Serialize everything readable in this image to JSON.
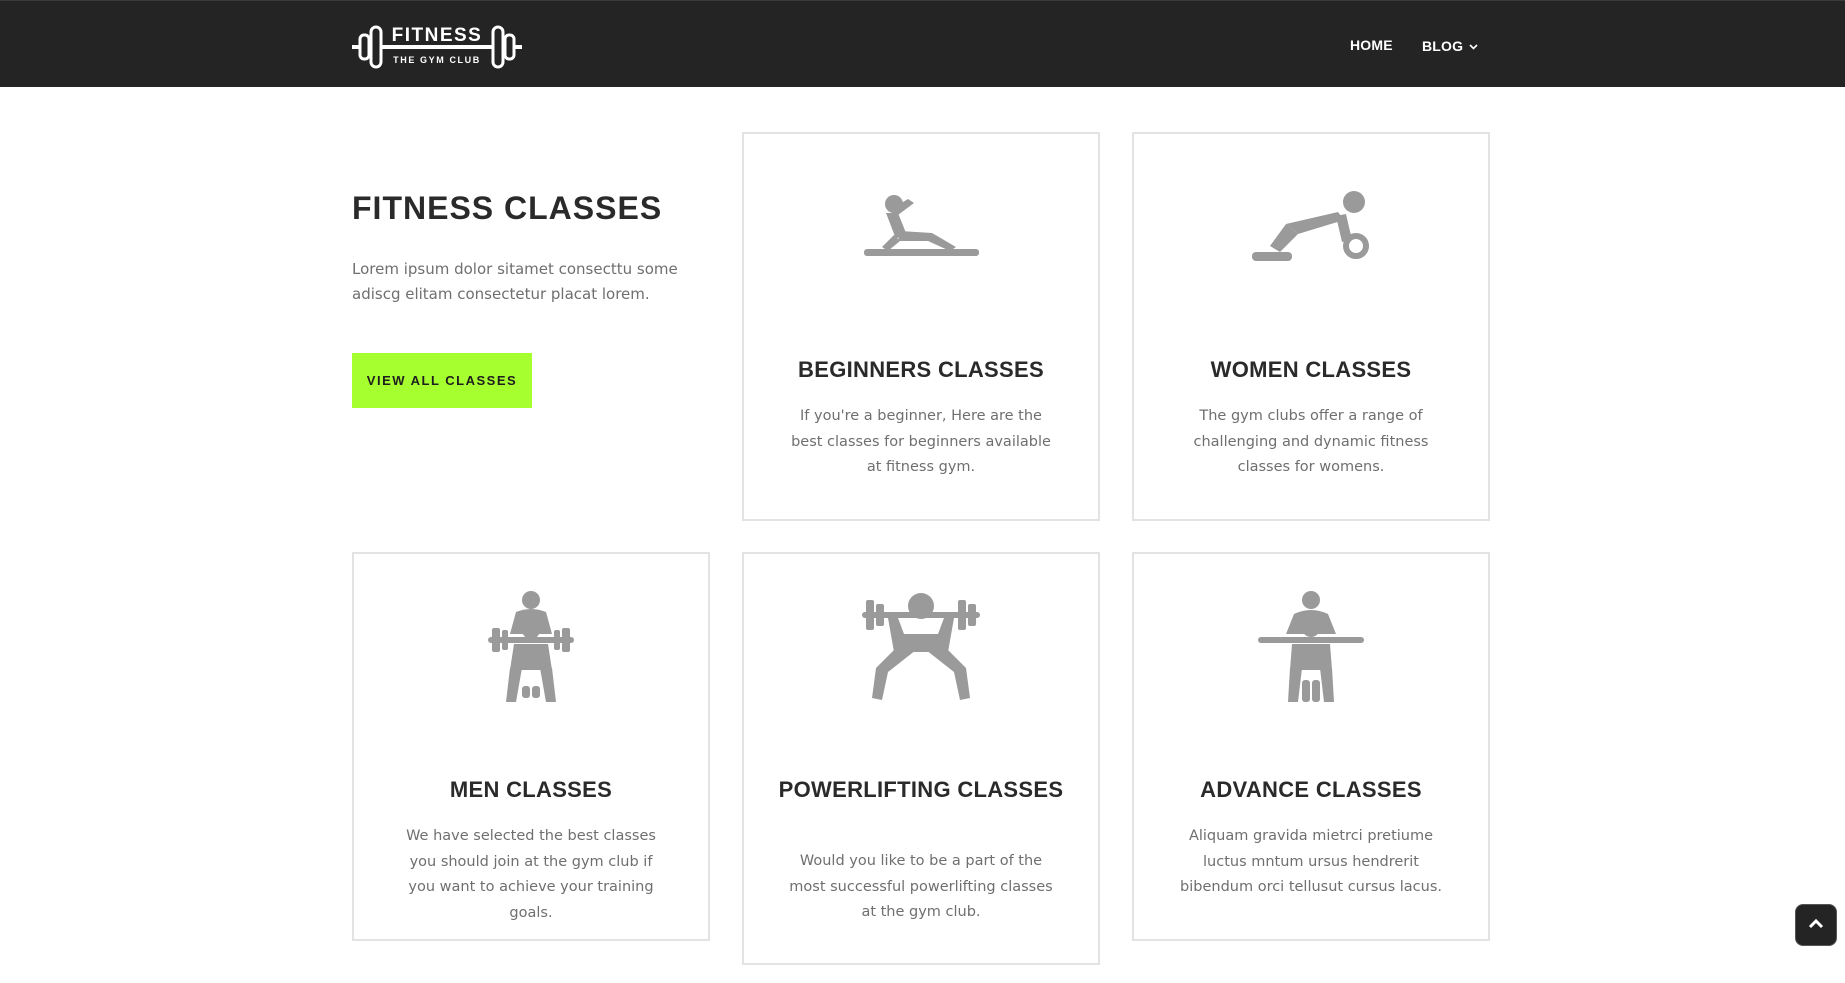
{
  "header": {
    "logo": {
      "title": "FITNESS",
      "subtitle": "THE GYM CLUB"
    },
    "nav": [
      {
        "label": "HOME"
      },
      {
        "label": "BLOG",
        "icon": "chevron-down-icon"
      }
    ]
  },
  "intro": {
    "title": "FITNESS CLASSES",
    "text": "Lorem ipsum dolor sitamet consecttu some adiscg elitam consectetur placat lorem.",
    "button": "VIEW ALL CLASSES"
  },
  "cards": [
    {
      "icon": "beginner-exercise-icon",
      "title": "BEGINNERS CLASSES",
      "text": "If you're a beginner, Here are the best classes for beginners available at fitness gym."
    },
    {
      "icon": "women-exercise-icon",
      "title": "WOMEN CLASSES",
      "text": "The gym clubs offer a range of challenging and dynamic fitness classes for womens."
    },
    {
      "icon": "men-exercise-icon",
      "title": "MEN CLASSES",
      "text": "We have selected the best classes you should join at the gym club if you want to achieve your training goals."
    },
    {
      "icon": "powerlifting-icon",
      "title": "POWERLIFTING CLASSES",
      "text": "Would you like to be a part of the most successful powerlifting classes at the gym club."
    },
    {
      "icon": "advance-exercise-icon",
      "title": "ADVANCE CLASSES",
      "text": "Aliquam gravida mietrci pretiume luctus mntum ursus hendrerit bibendum orci tellusut cursus lacus."
    }
  ],
  "colors": {
    "header_bg": "#242424",
    "accent": "#a6ff2e",
    "icon_gray": "#9a9a9a"
  },
  "scroll_top_icon": "chevron-up-icon"
}
